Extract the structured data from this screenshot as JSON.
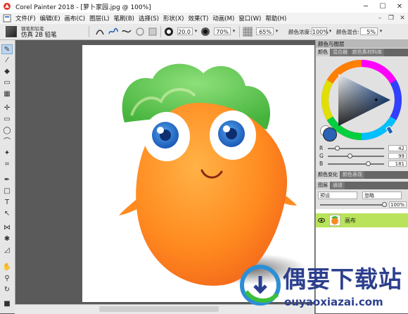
{
  "window": {
    "title": "Corel Painter 2018 - [萝卜家园.jpg @ 100%]",
    "minimize": "─",
    "maximize": "☐",
    "close": "✕"
  },
  "menu": {
    "items": [
      "文件(F)",
      "编辑(E)",
      "画布(C)",
      "图层(L)",
      "笔刷(B)",
      "选择(S)",
      "形状(X)",
      "效果(T)",
      "动画(M)",
      "窗口(W)",
      "帮助(H)"
    ],
    "mdi_min": "–",
    "mdi_restore": "❐",
    "mdi_close": "✕"
  },
  "brush": {
    "category": "钢笔和铅笔",
    "variant": "仿真 2B 铅笔"
  },
  "propbar": {
    "size": "20.0",
    "opacity": "70%",
    "grain": "65%",
    "color_variability_label": "颜色浓度:",
    "color_variability": "100%",
    "color_mix_label": "颜色混合:",
    "color_mix": "5%"
  },
  "panels": {
    "color_group_title": "颜色与图层",
    "color_tabs": [
      "颜色",
      "混合器",
      "颜色集材料库"
    ],
    "rgb": [
      {
        "label": "R",
        "value": "42",
        "fraction": 0.16
      },
      {
        "label": "G",
        "value": "99",
        "fraction": 0.39
      },
      {
        "label": "B",
        "value": "181",
        "fraction": 0.71
      }
    ],
    "color_tabs2": [
      "颜色变化",
      "颜色表现"
    ],
    "layers_tabs": [
      "图层",
      "通道"
    ],
    "layer_mode": "预设",
    "layer_composite": "忽略",
    "layer_opacity": "100%",
    "layer_name": "画布",
    "main_color": "#2a63b5"
  },
  "watermark": {
    "main": "偶要下载站",
    "sub": "ouyaoxiazai.com"
  }
}
